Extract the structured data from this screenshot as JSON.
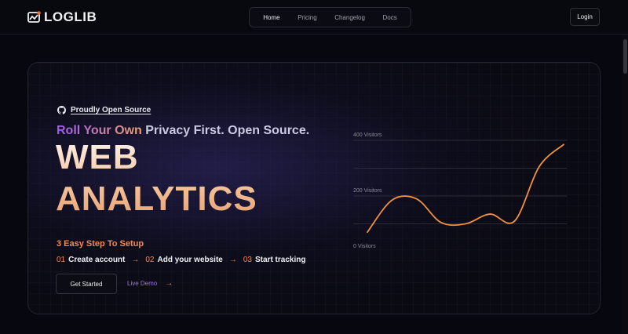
{
  "brand": {
    "name": "LOGLIB",
    "accent": "#ef8a55"
  },
  "nav": {
    "items": [
      {
        "label": "Home"
      },
      {
        "label": "Pricing"
      },
      {
        "label": "Changelog"
      },
      {
        "label": "Docs"
      }
    ],
    "login": "Login"
  },
  "hero": {
    "open_source": "Proudly Open Source",
    "tagline_a": "Roll Your Own",
    "tagline_b": "Privacy First. Open Source.",
    "title_1": "WEB",
    "title_2": "ANALYTICS",
    "steps_title": "3 Easy Step To Setup",
    "steps": [
      {
        "num": "01",
        "label": "Create account"
      },
      {
        "num": "02",
        "label": "Add your website"
      },
      {
        "num": "03",
        "label": "Start tracking"
      }
    ],
    "cta": "Get Started",
    "demo": "Live Demo"
  },
  "chart_data": {
    "type": "line",
    "ylabels": [
      "400 Visitors",
      "200 Visitors",
      "0 Visitors"
    ],
    "ylim": [
      0,
      400
    ],
    "color": "#f0923e",
    "series": [
      {
        "values": [
          70,
          185,
          190,
          105,
          100,
          135,
          110,
          305,
          385
        ]
      }
    ]
  }
}
